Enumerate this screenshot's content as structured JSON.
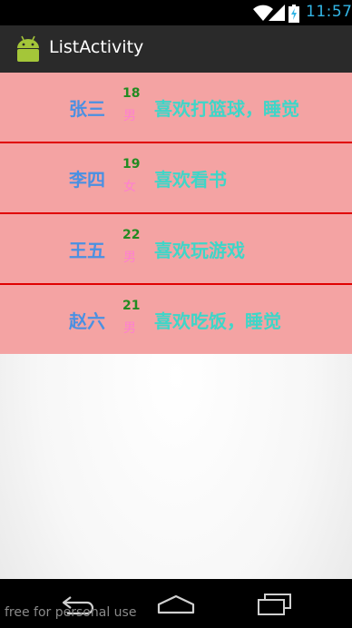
{
  "status_bar": {
    "time": "11:57",
    "icons": [
      "wifi-icon",
      "signal-icon",
      "battery-charging-icon"
    ]
  },
  "action_bar": {
    "title": "ListActivity",
    "icon": "android-robot-icon"
  },
  "list": {
    "items": [
      {
        "name": "张三",
        "age": "18",
        "gender": "男",
        "hobby": "喜欢打篮球，睡觉"
      },
      {
        "name": "李四",
        "age": "19",
        "gender": "女",
        "hobby": "喜欢看书"
      },
      {
        "name": "王五",
        "age": "22",
        "gender": "男",
        "hobby": "喜欢玩游戏"
      },
      {
        "name": "赵六",
        "age": "21",
        "gender": "男",
        "hobby": "喜欢吃饭，睡觉"
      }
    ]
  },
  "nav_bar": {
    "icons": [
      "back-icon",
      "home-icon",
      "recent-apps-icon"
    ]
  },
  "watermark": "free for personal use",
  "colors": {
    "row_background": "#f4a3a3",
    "divider": "#e00000",
    "name": "#4a90e2",
    "age": "#228b22",
    "gender": "#ff7fd0",
    "hobby": "#3ed6c8",
    "clock": "#33b5e5"
  }
}
